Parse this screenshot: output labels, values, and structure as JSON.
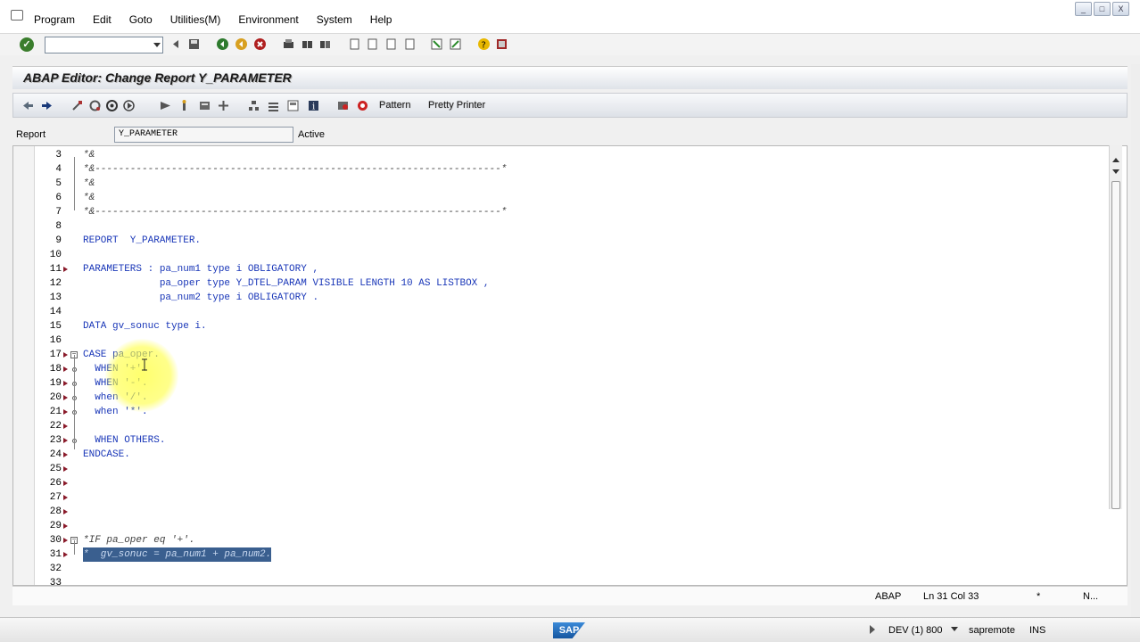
{
  "menu": {
    "items": [
      "Program",
      "Edit",
      "Goto",
      "Utilities(M)",
      "Environment",
      "System",
      "Help"
    ]
  },
  "window_controls": [
    "_",
    "□",
    "X"
  ],
  "command_field": {
    "value": "",
    "placeholder": ""
  },
  "title": "ABAP Editor: Change Report Y_PARAMETER",
  "app_toolbar": {
    "pattern_label": "Pattern",
    "pretty_printer_label": "Pretty Printer"
  },
  "report": {
    "label": "Report",
    "value": "Y_PARAMETER",
    "status": "Active"
  },
  "code_lines": [
    {
      "n": "3",
      "text": "*&"
    },
    {
      "n": "4",
      "text": "*&---------------------------------------------------------------------*"
    },
    {
      "n": "5",
      "text": "*&"
    },
    {
      "n": "6",
      "text": "*&"
    },
    {
      "n": "7",
      "text": "*&---------------------------------------------------------------------*"
    },
    {
      "n": "8",
      "text": ""
    },
    {
      "n": "9",
      "text": "REPORT  Y_PARAMETER."
    },
    {
      "n": "10",
      "text": ""
    },
    {
      "n": "11",
      "text": "PARAMETERS : pa_num1 type i OBLIGATORY ,"
    },
    {
      "n": "12",
      "text": "             pa_oper type Y_DTEL_PARAM VISIBLE LENGTH 10 AS LISTBOX ,"
    },
    {
      "n": "13",
      "text": "             pa_num2 type i OBLIGATORY ."
    },
    {
      "n": "14",
      "text": ""
    },
    {
      "n": "15",
      "text": "DATA gv_sonuc type i."
    },
    {
      "n": "16",
      "text": ""
    },
    {
      "n": "17",
      "text": "CASE pa_oper."
    },
    {
      "n": "18",
      "text": "  WHEN '+'."
    },
    {
      "n": "19",
      "text": "  WHEN '-'."
    },
    {
      "n": "20",
      "text": "  when '/'."
    },
    {
      "n": "21",
      "text": "  when '*'."
    },
    {
      "n": "22",
      "text": ""
    },
    {
      "n": "23",
      "text": "  WHEN OTHERS."
    },
    {
      "n": "24",
      "text": "ENDCASE."
    },
    {
      "n": "25",
      "text": ""
    },
    {
      "n": "26",
      "text": ""
    },
    {
      "n": "27",
      "text": ""
    },
    {
      "n": "28",
      "text": ""
    },
    {
      "n": "29",
      "text": ""
    },
    {
      "n": "30",
      "text": "*IF pa_oper eq '+'."
    },
    {
      "n": "31",
      "text": "*  gv_sonuc = pa_num1 + pa_num2."
    },
    {
      "n": "32",
      "text": ""
    },
    {
      "n": "33",
      "text": ""
    }
  ],
  "editor_status": {
    "mode": "ABAP",
    "position": "Ln  31 Col  33",
    "marker": "*",
    "more": "N..."
  },
  "system_status": {
    "logo": "SAP",
    "system": "DEV (1) 800",
    "server": "sapremote",
    "ins": "INS"
  },
  "colors": {
    "keyword": "#1a37b8",
    "selection": "#3a5f8f",
    "marker": "#8a1a2a",
    "highlight": "#ffff3c"
  }
}
